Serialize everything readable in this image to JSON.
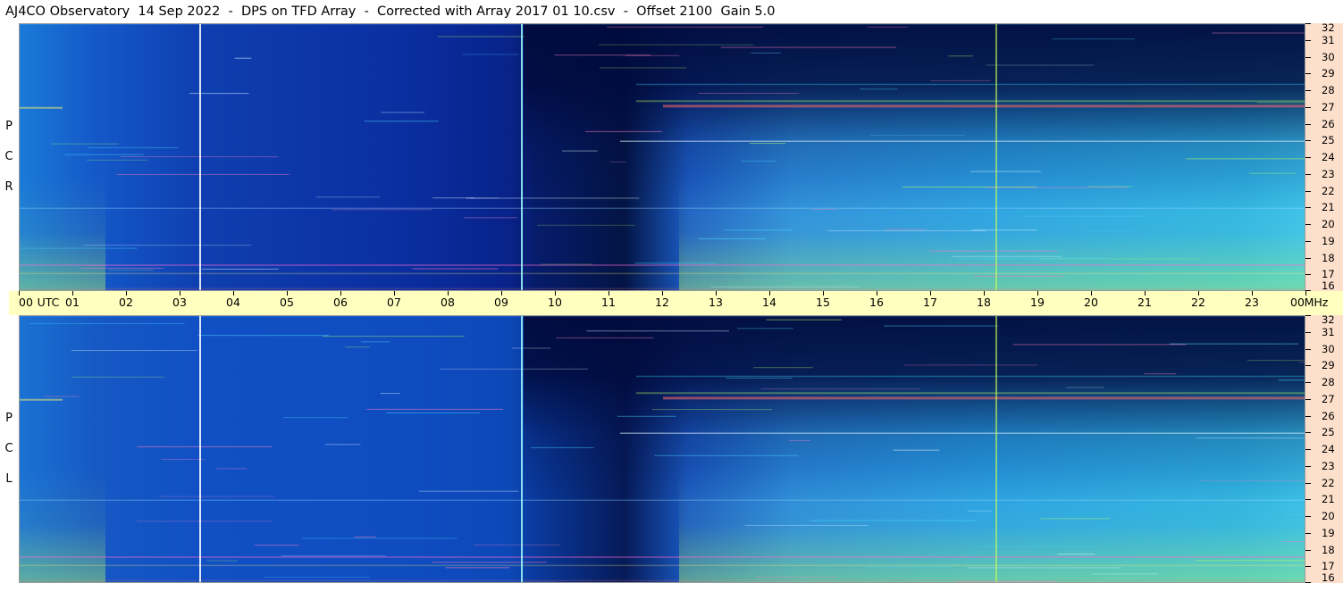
{
  "title": "AJ4CO Observatory  14 Sep 2022  -  DPS on TFD Array  -  Corrected with Array 2017 01 10.csv  -  Offset 2100  Gain 5.0",
  "panels": {
    "top": {
      "label_letters": [
        "R",
        "C",
        "P"
      ]
    },
    "bottom": {
      "label_letters": [
        "L",
        "C",
        "P"
      ]
    }
  },
  "time_axis": {
    "labels": [
      "00",
      "01",
      "02",
      "03",
      "04",
      "05",
      "06",
      "07",
      "08",
      "09",
      "10",
      "11",
      "12",
      "13",
      "14",
      "15",
      "16",
      "17",
      "18",
      "19",
      "20",
      "21",
      "22",
      "23",
      "00"
    ],
    "utc_label": "UTC",
    "unit_label": "MHz"
  },
  "freq_axis": {
    "labels": [
      "32",
      "31",
      "30",
      "29",
      "28",
      "27",
      "26",
      "25",
      "24",
      "23",
      "22",
      "21",
      "20",
      "19",
      "18",
      "17",
      "16"
    ]
  },
  "chart_data": {
    "type": "heatmap",
    "title": "AJ4CO Observatory  14 Sep 2022  -  DPS on TFD Array  -  Corrected with Array 2017 01 10.csv  -  Offset 2100  Gain 5.0",
    "xlabel": "UTC",
    "ylabel": "MHz",
    "xlim": [
      0,
      24
    ],
    "ylim": [
      16,
      32
    ],
    "panels": [
      "RCP",
      "LCP"
    ],
    "colors": {
      "low": "#000a3c",
      "mid": "#1450ff",
      "high": "#46c8ff",
      "peak": "#b4ff64"
    },
    "vertical_markers_utc": [
      3.35,
      9.35,
      18.2
    ],
    "notable_bands_mhz": [
      27.1,
      25.0,
      21.0,
      17.6,
      17.1
    ]
  }
}
